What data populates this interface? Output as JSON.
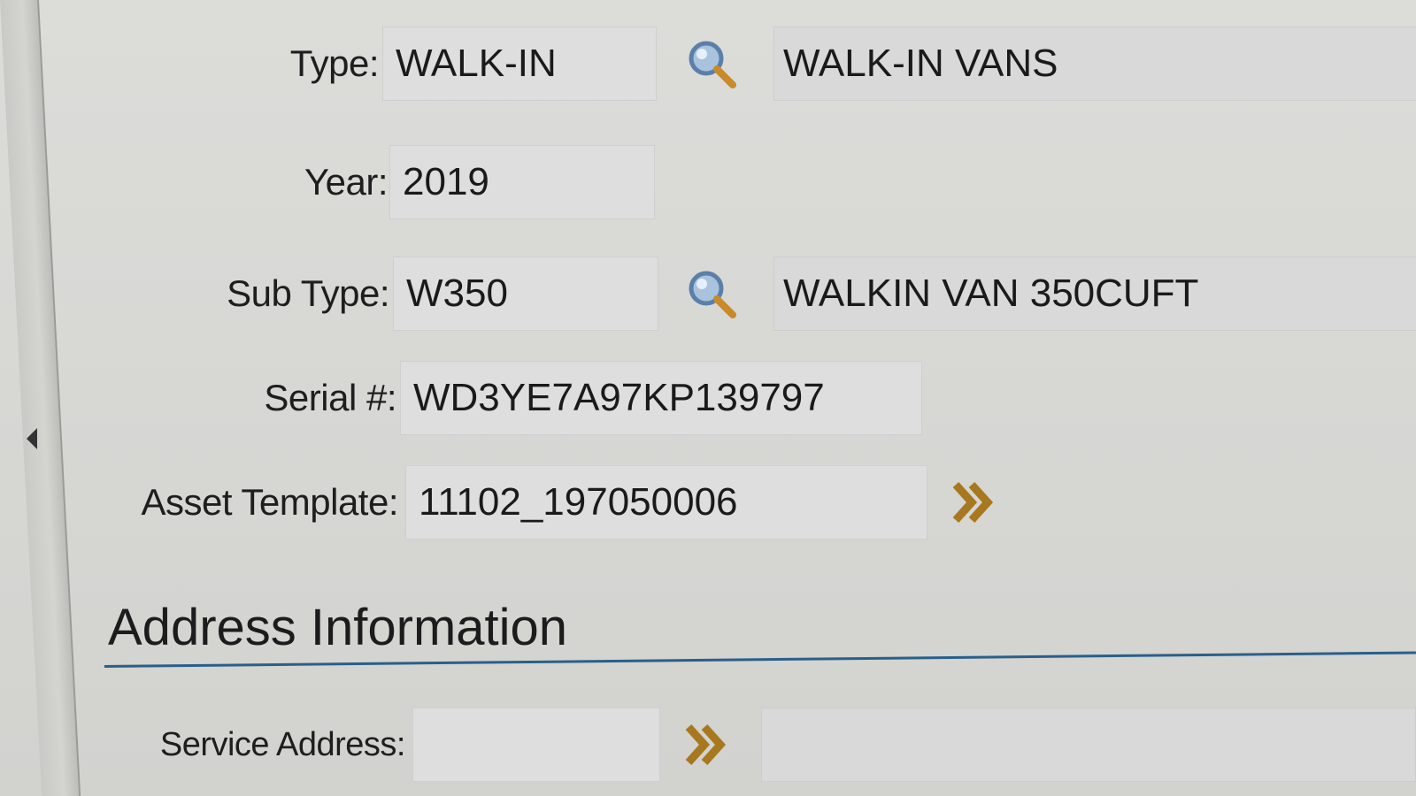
{
  "asset": {
    "type": {
      "label": "Type:",
      "value": "WALK-IN",
      "description": "WALK-IN VANS"
    },
    "year": {
      "label": "Year:",
      "value": "2019"
    },
    "sub_type": {
      "label": "Sub Type:",
      "value": "W350",
      "description": "WALKIN VAN 350CUFT"
    },
    "serial": {
      "label": "Serial #:",
      "value": "WD3YE7A97KP139797"
    },
    "asset_template": {
      "label": "Asset Template:",
      "value": "11102_197050006"
    }
  },
  "address_section": {
    "title": "Address Information",
    "service_address": {
      "label": "Service Address:",
      "value": "",
      "description": ""
    }
  },
  "icons": {
    "lookup": "magnifier-search-icon",
    "navigate": "double-chevron-right-icon",
    "collapse": "triangle-left-icon"
  },
  "colors": {
    "section_rule": "#2a5f8a",
    "lookup_glass": "#5b7fa8",
    "lookup_handle": "#c88a2a",
    "navigate_icon": "#a8781e"
  }
}
